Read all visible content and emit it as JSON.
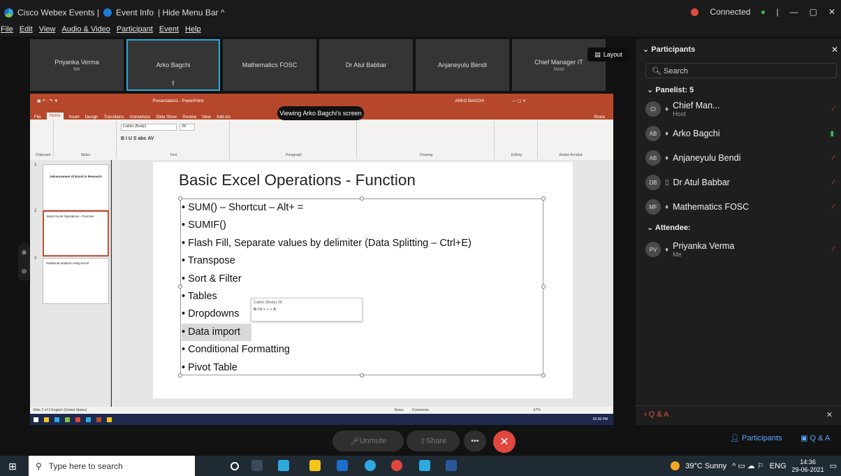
{
  "window": {
    "title": "Cisco Webex Events |",
    "event_info": "Event Info",
    "hide_menu": "| Hide Menu Bar ^",
    "status": "Connected",
    "status_dot": "•",
    "sep": "|",
    "min": "—",
    "restore": "▢",
    "close": "✕"
  },
  "menu": [
    "File",
    "Edit",
    "View",
    "Audio & Video",
    "Participant",
    "Event",
    "Help"
  ],
  "thumbnails": [
    {
      "name": "Priyanka Verma",
      "sub": "Me"
    },
    {
      "name": "Arko Bagchi",
      "sub": ""
    },
    {
      "name": "Mathematics FOSC",
      "sub": ""
    },
    {
      "name": "Dr Atul Babbar",
      "sub": ""
    },
    {
      "name": "Anjaneyulu Bendi",
      "sub": ""
    },
    {
      "name": "Chief Manager IT",
      "sub": "Host"
    }
  ],
  "layout_label": "Layout",
  "viewing_banner": "Viewing Arko Bagchi's screen",
  "ppt": {
    "title": "Presentation1 - PowerPoint",
    "user": "ARKO BAGCHI",
    "tabs": [
      "File",
      "Home",
      "Insert",
      "Design",
      "Transitions",
      "Animations",
      "Slide Show",
      "Review",
      "View",
      "Add-ins",
      "Help",
      "Tell me what you want to do"
    ],
    "share": "Share",
    "groups": [
      "Clipboard",
      "Slides",
      "Font",
      "Paragraph",
      "Drawing",
      "Editing",
      "Adobe Acrobat"
    ],
    "font_name": "Calibri (Body)",
    "font_size": "28",
    "slide_thumbs": [
      {
        "num": "1",
        "title": "Advancement of Excel in Research"
      },
      {
        "num": "2",
        "title": "Basic Excel Operations - Function"
      },
      {
        "num": "3",
        "title": "Statistical analysis using Excel"
      }
    ],
    "slide_title": "Basic Excel Operations - Function",
    "bullets": [
      "SUM() – Shortcut – Alt+ =",
      "SUMIF()",
      "Flash Fill, Separate values by delimiter (Data Splitting – Ctrl+E)",
      "Transpose",
      "Sort & Filter",
      "Tables",
      "Dropdowns",
      "Data import",
      "Conditional Formatting",
      "Pivot Table"
    ],
    "status": "Slide 2 of 3    English (United States)",
    "notes": "Notes",
    "comments": "Comments",
    "zoom": "67%",
    "clock": "02:36 PM"
  },
  "panel": {
    "header": "Participants",
    "search_placeholder": "Search",
    "panelist": "Panelist: 5",
    "attendee": "Attendee:",
    "panelists": [
      {
        "initials": "CI",
        "name": "Chief Man...",
        "sub": "Host"
      },
      {
        "initials": "AB",
        "name": "Arko Bagchi",
        "sub": ""
      },
      {
        "initials": "AB",
        "name": "Anjaneyulu Bendi",
        "sub": ""
      },
      {
        "initials": "DB",
        "name": "Dr Atul Babbar",
        "sub": ""
      },
      {
        "initials": "MF",
        "name": "Mathematics FOSC",
        "sub": ""
      }
    ],
    "attendees": [
      {
        "initials": "PV",
        "name": "Priyanka Verma",
        "sub": "Me"
      }
    ],
    "qa": "Q & A"
  },
  "controls": {
    "unmute": "Unmute",
    "share": "Share",
    "more": "•••",
    "end": "✕",
    "participants": "Participants",
    "qa": "Q & A"
  },
  "taskbar": {
    "search": "Type here to search",
    "weather": "39°C Sunny",
    "lang": "ENG",
    "time": "14:36",
    "date": "29-06-2021"
  }
}
